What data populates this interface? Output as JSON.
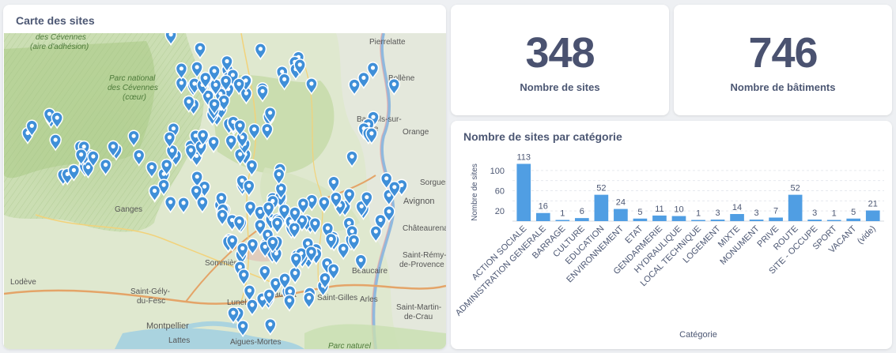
{
  "map_card": {
    "title": "Carte des sites",
    "labels": [
      "des Cévennes",
      "(aire d'adhésion)",
      "Parc national",
      "des Cévennes",
      "(cœur)",
      "Pierrelatte",
      "Bollène",
      "Bagnols-sur-",
      "Cèze",
      "Orange",
      "Sorgues",
      "Avignon",
      "Châteaurenard",
      "Ganges",
      "Sommières",
      "Saint-Rémy-",
      "de-Provence",
      "Beaucaire",
      "Lodève",
      "Saint-Gély-",
      "du-Fesc",
      "Lunel",
      "Montpellier",
      "Vauvert",
      "Saint-Gilles",
      "Arles",
      "Saint-Martin-",
      "de-Crau",
      "Lattes",
      "Aigues-Mortes",
      "Parc naturel"
    ]
  },
  "stats": [
    {
      "value": "348",
      "label": "Nombre de sites"
    },
    {
      "value": "746",
      "label": "Nombre de bâtiments"
    }
  ],
  "chart_card": {
    "title": "Nombre de sites par catégorie"
  },
  "chart_data": {
    "type": "bar",
    "categories": [
      "ACTION SOCIALE",
      "ADMINISTRATION GENERALE",
      "BARRAGE",
      "CULTURE",
      "EDUCATION",
      "ENVIRONNEMENT",
      "ETAT",
      "GENDARMERIE",
      "HYDRAULIQUE",
      "LOCAL TECHNIQUE",
      "LOGEMENT",
      "MIXTE",
      "MONUMENT",
      "PRIVE",
      "ROUTE",
      "SITE - OCCUPE",
      "SPORT",
      "VACANT",
      "(vide)"
    ],
    "values": [
      113,
      16,
      1,
      6,
      52,
      24,
      5,
      11,
      10,
      1,
      3,
      14,
      3,
      7,
      52,
      3,
      1,
      5,
      21
    ],
    "xlabel": "Catégorie",
    "ylabel": "Nombre de sites",
    "yticks": [
      20,
      40,
      60,
      80,
      100
    ],
    "ylim": [
      0,
      120
    ],
    "grid": true,
    "bar_color": "#509ee3"
  }
}
